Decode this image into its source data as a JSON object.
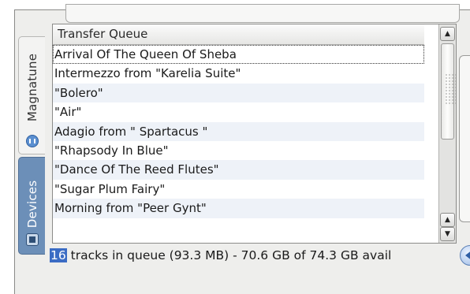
{
  "sidebar": {
    "tabs": [
      {
        "label": "Magnatune",
        "icon": "magnatune-icon"
      },
      {
        "label": "Devices",
        "icon": "device-icon"
      }
    ]
  },
  "queue": {
    "header": "Transfer Queue",
    "rows": [
      "Arrival Of The Queen Of Sheba",
      "Intermezzo from \"Karelia Suite\"",
      "\"Bolero\"",
      "\"Air\"",
      "Adagio from \" Spartacus \"",
      "\"Rhapsody In Blue\"",
      "\"Dance Of The Reed Flutes\"",
      "\"Sugar Plum Fairy\"",
      "Morning  from \"Peer Gynt\""
    ]
  },
  "status": {
    "count": "16",
    "text": " tracks in queue (93.3 MB) - 70.6 GB of 74.3 GB avail"
  },
  "colors": {
    "selection": "#3b6cc4",
    "devices_tab": "#6c8fb8",
    "row_alt": "#eef2f8"
  }
}
